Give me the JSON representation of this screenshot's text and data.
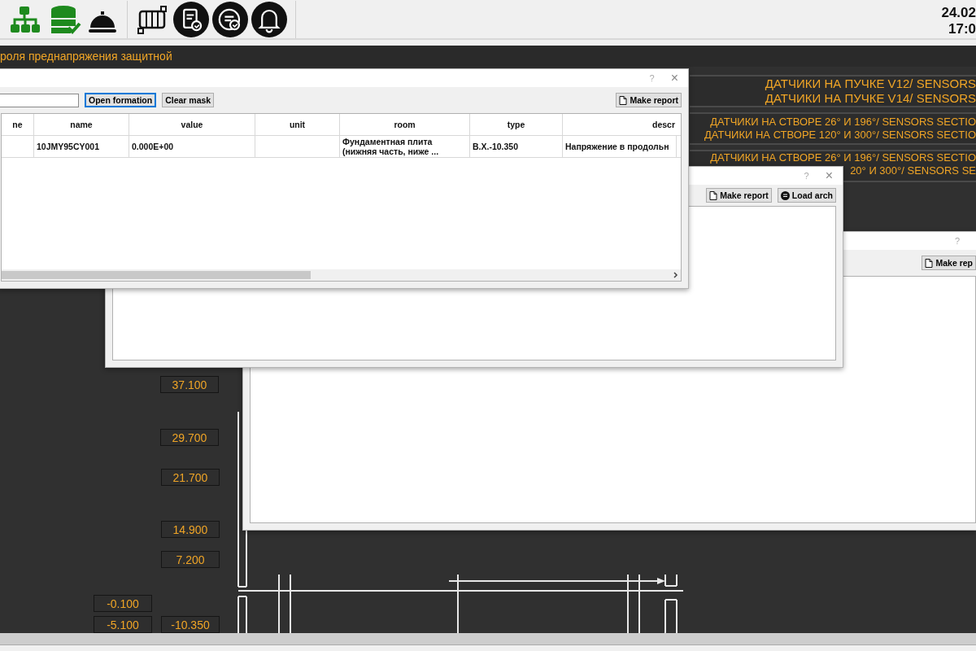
{
  "clock": {
    "date": "24.02",
    "time": "17:0"
  },
  "header": {
    "title": "роля преднапряжения защитной"
  },
  "sensor_groups": [
    {
      "lines": [
        "ДАТЧИКИ НА ПУЧКЕ V12/ SENSORS",
        "ДАТЧИКИ НА ПУЧКЕ V14/ SENSORS"
      ]
    },
    {
      "lines": [
        "ДАТЧИКИ НА СТВОРЕ 26° И 196°/ SENSORS SECTIO",
        "ДАТЧИКИ НА СТВОРЕ 120° И 300°/ SENSORS SECTIO"
      ]
    },
    {
      "lines": [
        "ДАТЧИКИ НА СТВОРЕ 26° И 196°/ SENSORS SECTIO",
        "20° И 300°/ SENSORS SE"
      ]
    }
  ],
  "elevations": [
    {
      "label": "37.100"
    },
    {
      "label": "29.700"
    },
    {
      "label": "21.700"
    },
    {
      "label": "14.900"
    },
    {
      "label": "7.200"
    },
    {
      "label": "-0.100"
    },
    {
      "label": "-5.100"
    },
    {
      "label": "-10.350"
    }
  ],
  "formation_dialog": {
    "help": "?",
    "close": "×",
    "buttons": [
      {
        "label": "Open formation",
        "focused": true
      },
      {
        "label": "Clear mask",
        "focused": false
      }
    ],
    "report_button": "Make report",
    "table": {
      "columns": [
        "ne",
        "name",
        "value",
        "unit",
        "room",
        "type",
        "descr"
      ],
      "rows": [
        [
          null,
          "10JMY95CY001",
          "0.000E+00",
          null,
          "Фундаментная плита\n(нижняя часть, ниже ...",
          "B.X.-10.350",
          "Напряжение в продольн"
        ]
      ]
    }
  },
  "archive_dialog": {
    "help": "?",
    "close": "×",
    "buttons": [
      {
        "label": "Make report",
        "kind": "report"
      },
      {
        "label": "Load arch",
        "kind": "archive"
      }
    ]
  },
  "report_dialog": {
    "help": "?",
    "buttons": [
      {
        "label": "Make rep",
        "kind": "report"
      }
    ]
  }
}
